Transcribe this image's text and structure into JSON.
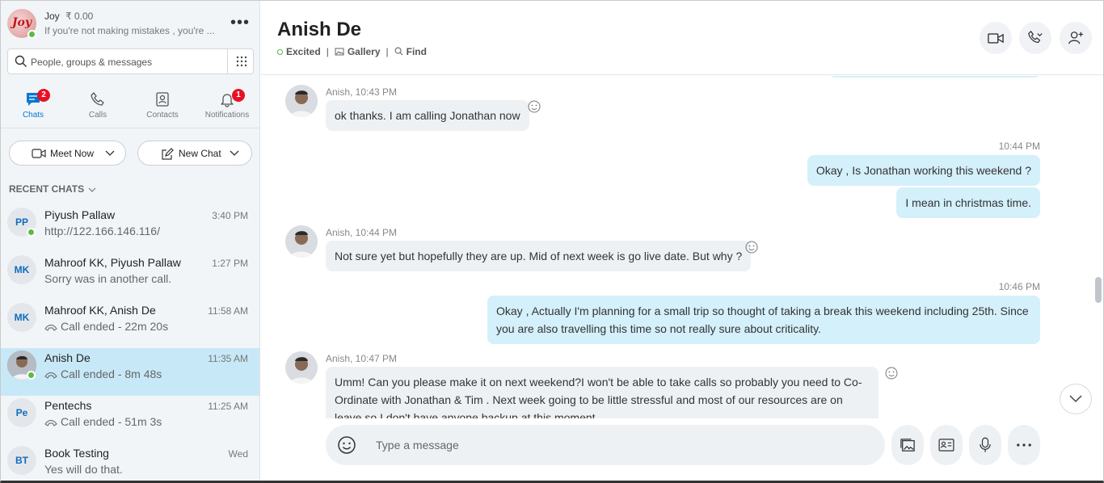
{
  "profile": {
    "name": "Joy",
    "credit": "₹ 0.00",
    "mood": "If you're not making mistakes , you're ...",
    "avatar_text": "Joy"
  },
  "search": {
    "placeholder": "People, groups & messages"
  },
  "nav": {
    "tabs": [
      {
        "label": "Chats",
        "badge": "2",
        "icon": "chat-icon"
      },
      {
        "label": "Calls",
        "icon": "phone-icon"
      },
      {
        "label": "Contacts",
        "icon": "contacts-icon"
      },
      {
        "label": "Notifications",
        "badge": "1",
        "icon": "bell-icon"
      }
    ]
  },
  "actions": {
    "meet_now": "Meet Now",
    "new_chat": "New Chat"
  },
  "recent_header": "RECENT CHATS",
  "chats": [
    {
      "initials": "PP",
      "name": "Piyush Pallaw",
      "time": "3:40 PM",
      "preview": "http://122.166.146.116/",
      "call": false
    },
    {
      "initials": "MK",
      "name": "Mahroof KK, Piyush Pallaw",
      "time": "1:27 PM",
      "preview": "Sorry was in another call.",
      "call": false
    },
    {
      "initials": "MK",
      "name": "Mahroof KK, Anish De",
      "time": "11:58 AM",
      "preview": "Call ended - 22m 20s",
      "call": true
    },
    {
      "initials": "",
      "name": "Anish De",
      "time": "11:35 AM",
      "preview": "Call ended - 8m 48s",
      "call": true
    },
    {
      "initials": "Pe",
      "name": "Pentechs",
      "time": "11:25 AM",
      "preview": "Call ended - 51m 3s",
      "call": true
    },
    {
      "initials": "BT",
      "name": "Book Testing",
      "time": "Wed",
      "preview": "Yes will do that.",
      "call": false
    }
  ],
  "conversation": {
    "title": "Anish De",
    "status": "Excited",
    "gallery": "Gallery",
    "find": "Find",
    "separator": "|"
  },
  "messages": [
    {
      "meta": "Anish, 10:43 PM",
      "text": "ok thanks. I am calling Jonathan now"
    },
    {
      "time": "10:44 PM",
      "text": "Okay , Is Jonathan  working this weekend ?"
    },
    {
      "text": "I mean in christmas time."
    },
    {
      "meta": "Anish, 10:44 PM",
      "text": "Not sure yet but hopefully they are up. Mid of next week is go live date. But why ?"
    },
    {
      "time": "10:46 PM",
      "text": "Okay , Actually I'm planning for a small trip so thought of taking a break this weekend including 25th. Since you are also travelling this time so not really sure about criticality."
    },
    {
      "meta": "Anish, 10:47 PM",
      "text": "Umm! Can you please make it on next weekend?I won't be able to take calls so probably you need to Co-Ordinate with Jonathan & Tim . Next week going to be little stressful and most of our resources are on leave so I don't have anyone backup at this moment."
    }
  ],
  "composer": {
    "placeholder": "Type a message"
  },
  "colors": {
    "accent": "#0078d4",
    "outgoing_bubble": "#d4f0fb",
    "incoming_bubble": "#eef1f4",
    "presence": "#5cba47",
    "badge": "#e81123"
  }
}
